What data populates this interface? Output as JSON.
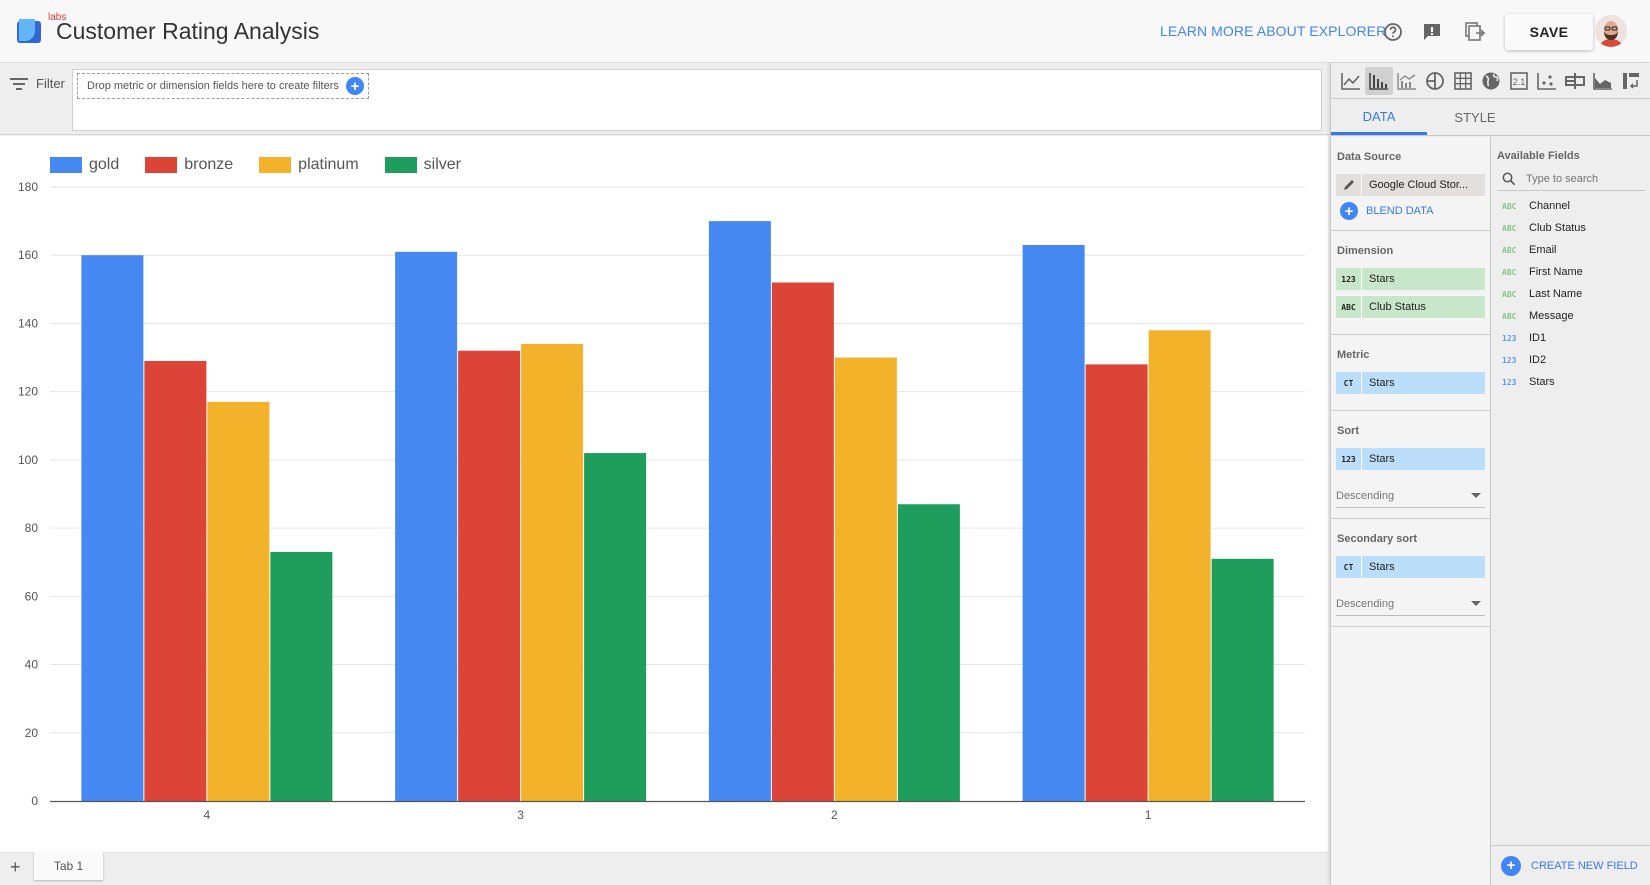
{
  "header": {
    "labs_badge": "labs",
    "title": "Customer Rating Analysis",
    "learn_more": "LEARN MORE ABOUT EXPLORER",
    "save_label": "SAVE",
    "icons": [
      "help-icon",
      "feedback-icon",
      "export-icon"
    ]
  },
  "filter": {
    "label": "Filter",
    "hint": "Drop metric or dimension fields here to create filters"
  },
  "tabs_bar": {
    "add_label": "+",
    "tabs": [
      {
        "label": "Tab 1"
      }
    ]
  },
  "right_panel": {
    "chart_types": [
      "time-series",
      "bar",
      "combo",
      "pie",
      "table",
      "geo",
      "scorecard",
      "scatter",
      "bullet",
      "area",
      "pivot"
    ],
    "active_chart_type": "bar",
    "tabs": [
      {
        "label": "DATA",
        "active": true
      },
      {
        "label": "STYLE",
        "active": false
      }
    ],
    "data_source": {
      "title": "Data Source",
      "value": "Google Cloud Stor...",
      "blend_label": "BLEND DATA"
    },
    "dimension": {
      "title": "Dimension",
      "items": [
        {
          "type": "123",
          "label": "Stars"
        },
        {
          "type": "ABC",
          "label": "Club Status"
        }
      ]
    },
    "metric": {
      "title": "Metric",
      "items": [
        {
          "type": "CT",
          "label": "Stars"
        }
      ]
    },
    "sort": {
      "title": "Sort",
      "item": {
        "type": "123",
        "label": "Stars"
      },
      "order": "Descending"
    },
    "secondary_sort": {
      "title": "Secondary sort",
      "item": {
        "type": "CT",
        "label": "Stars"
      },
      "order": "Descending"
    },
    "available_fields": {
      "title": "Available Fields",
      "search_placeholder": "Type to search",
      "fields": [
        {
          "type": "ABC",
          "kind": "text",
          "label": "Channel"
        },
        {
          "type": "ABC",
          "kind": "text",
          "label": "Club Status"
        },
        {
          "type": "ABC",
          "kind": "text",
          "label": "Email"
        },
        {
          "type": "ABC",
          "kind": "text",
          "label": "First Name"
        },
        {
          "type": "ABC",
          "kind": "text",
          "label": "Last Name"
        },
        {
          "type": "ABC",
          "kind": "text",
          "label": "Message"
        },
        {
          "type": "123",
          "kind": "num",
          "label": "ID1"
        },
        {
          "type": "123",
          "kind": "num",
          "label": "ID2"
        },
        {
          "type": "123",
          "kind": "num",
          "label": "Stars"
        }
      ],
      "create_label": "CREATE NEW FIELD"
    }
  },
  "colors": {
    "accent": "#4285f4",
    "gold": "#4688f1",
    "bronze": "#db4437",
    "platinum": "#f2b32a",
    "silver": "#1f9d5c"
  },
  "chart_data": {
    "type": "bar",
    "title": "",
    "xlabel": "",
    "ylabel": "",
    "categories": [
      "4",
      "3",
      "2",
      "1"
    ],
    "series": [
      {
        "name": "gold",
        "color": "#4688f1",
        "values": [
          160,
          161,
          170,
          163
        ]
      },
      {
        "name": "bronze",
        "color": "#db4437",
        "values": [
          129,
          132,
          152,
          128
        ]
      },
      {
        "name": "platinum",
        "color": "#f2b32a",
        "values": [
          117,
          134,
          130,
          138
        ]
      },
      {
        "name": "silver",
        "color": "#1f9d5c",
        "values": [
          73,
          102,
          87,
          71
        ]
      }
    ],
    "ylim": [
      0,
      180
    ],
    "yticks": [
      0,
      20,
      40,
      60,
      80,
      100,
      120,
      140,
      160,
      180
    ],
    "grid": true,
    "legend": "top-left"
  }
}
